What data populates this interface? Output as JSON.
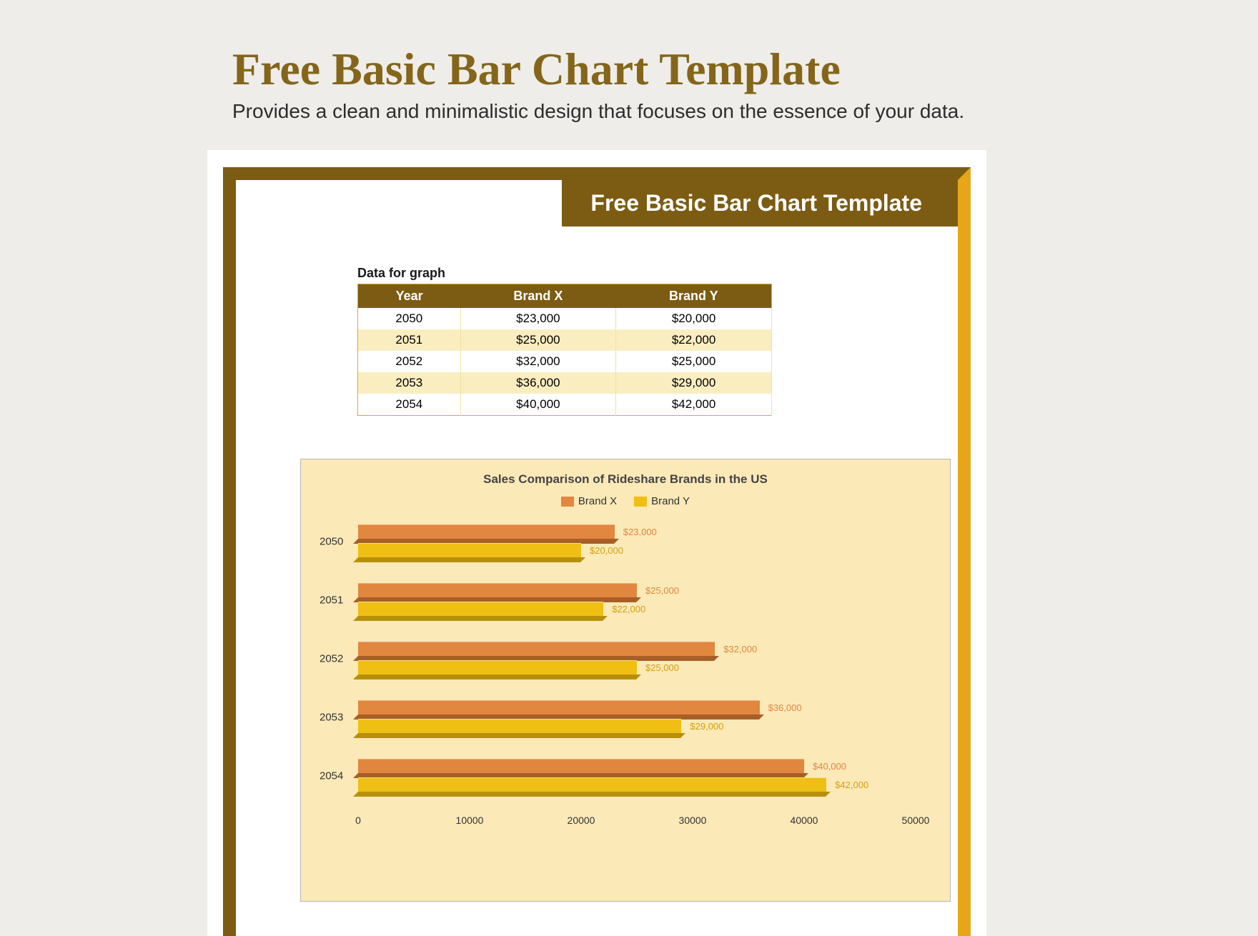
{
  "page": {
    "title": "Free Basic Bar Chart Template",
    "subtitle": "Provides a clean and minimalistic design that focuses on the essence of your data."
  },
  "doc": {
    "title_tab": "Free Basic Bar Chart Template",
    "table_caption": "Data for graph",
    "table": {
      "headers": [
        "Year",
        "Brand X",
        "Brand Y"
      ],
      "rows": [
        [
          "2050",
          "$23,000",
          "$20,000"
        ],
        [
          "2051",
          "$25,000",
          "$22,000"
        ],
        [
          "2052",
          "$32,000",
          "$25,000"
        ],
        [
          "2053",
          "$36,000",
          "$29,000"
        ],
        [
          "2054",
          "$40,000",
          "$42,000"
        ]
      ]
    }
  },
  "chart_data": {
    "type": "bar",
    "orientation": "horizontal",
    "title": "Sales Comparison of Rideshare Brands in the US",
    "categories": [
      "2050",
      "2051",
      "2052",
      "2053",
      "2054"
    ],
    "series": [
      {
        "name": "Brand X",
        "color": "#e1873f",
        "values": [
          23000,
          25000,
          32000,
          36000,
          40000
        ],
        "labels": [
          "$23,000",
          "$25,000",
          "$32,000",
          "$36,000",
          "$40,000"
        ]
      },
      {
        "name": "Brand Y",
        "color": "#efbf13",
        "values": [
          20000,
          22000,
          25000,
          29000,
          42000
        ],
        "labels": [
          "$20,000",
          "$22,000",
          "$25,000",
          "$29,000",
          "$42,000"
        ]
      }
    ],
    "xlim": [
      0,
      50000
    ],
    "xticks": [
      0,
      10000,
      20000,
      30000,
      40000,
      50000
    ],
    "xlabel": "",
    "ylabel": ""
  },
  "legend": {
    "brand_x": "Brand X",
    "brand_y": "Brand Y"
  }
}
